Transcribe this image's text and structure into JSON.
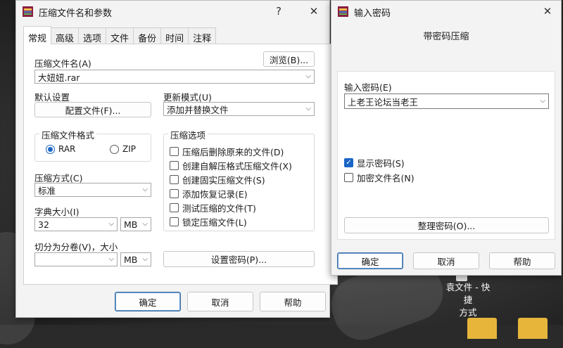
{
  "colors": {
    "accent": "#1a66c6",
    "rar_icon": "#8b1e3f"
  },
  "desktop": {
    "shortcut_label_line1": "袁文件 - 快捷",
    "shortcut_label_line2": "方式"
  },
  "main_dialog": {
    "title": "压缩文件名和参数",
    "help_glyph": "?",
    "close_glyph": "✕",
    "tabs": [
      "常规",
      "高级",
      "选项",
      "文件",
      "备份",
      "时间",
      "注释"
    ],
    "archive_name_label": "压缩文件名(A)",
    "browse_button": "浏览(B)...",
    "archive_name_value": "大妞妞.rar",
    "default_settings_label": "默认设置",
    "profiles_button": "配置文件(F)...",
    "update_mode_label": "更新模式(U)",
    "update_mode_value": "添加并替换文件",
    "format_group_label": "压缩文件格式",
    "format_rar": "RAR",
    "format_zip": "ZIP",
    "options_group_label": "压缩选项",
    "options": [
      "压缩后删除原来的文件(D)",
      "创建自解压格式压缩文件(X)",
      "创建固实压缩文件(S)",
      "添加恢复记录(E)",
      "测试压缩的文件(T)",
      "锁定压缩文件(L)"
    ],
    "method_label": "压缩方式(C)",
    "method_value": "标准",
    "dict_label": "字典大小(I)",
    "dict_value": "32",
    "dict_unit": "MB",
    "split_label": "切分为分卷(V)，大小",
    "split_value": "",
    "split_unit": "MB",
    "set_password_button": "设置密码(P)...",
    "ok": "确定",
    "cancel": "取消",
    "help": "帮助"
  },
  "password_dialog": {
    "title": "输入密码",
    "close_glyph": "✕",
    "heading": "带密码压缩",
    "enter_label": "输入密码(E)",
    "password_value": "上老王论坛当老王",
    "show_password": "显示密码(S)",
    "show_password_checked": true,
    "encrypt_names": "加密文件名(N)",
    "encrypt_names_checked": false,
    "organize_button": "整理密码(O)...",
    "ok": "确定",
    "cancel": "取消",
    "help": "帮助"
  }
}
